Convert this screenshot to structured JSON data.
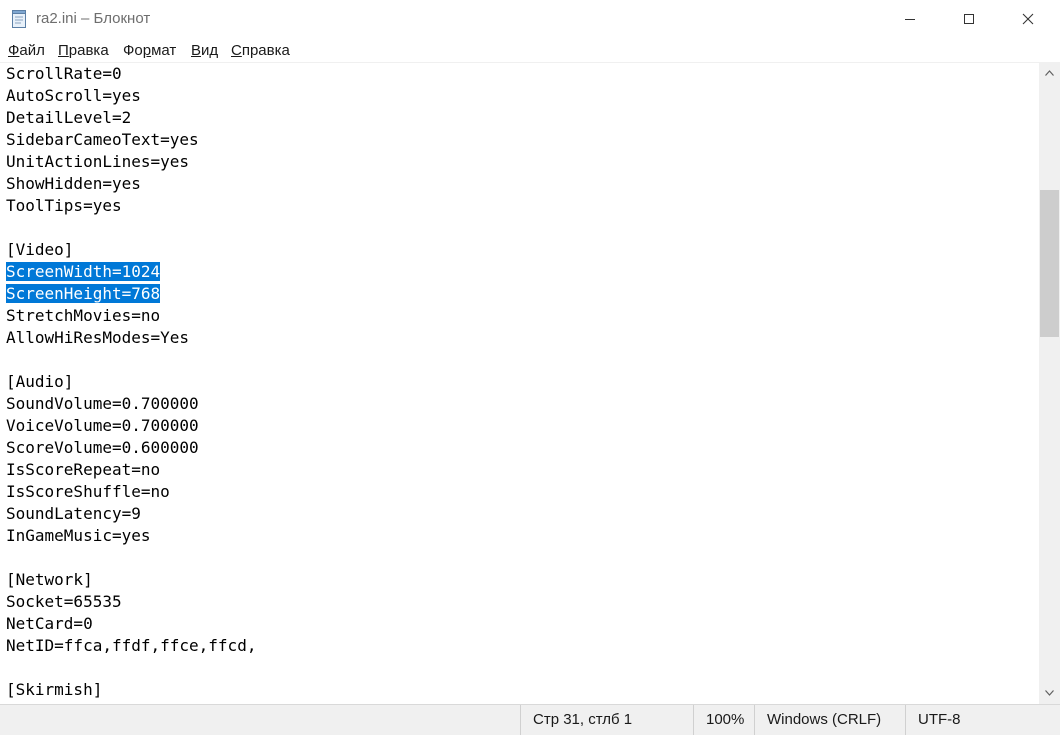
{
  "window": {
    "title": "ra2.ini – Блокнот",
    "icon": "notepad-icon",
    "controls": [
      "minimize-icon",
      "maximize-icon",
      "close-icon"
    ]
  },
  "menu": [
    {
      "accel": "Ф",
      "rest": "айл"
    },
    {
      "accel": "П",
      "rest": "равка"
    },
    {
      "accel": "",
      "pre": "Фо",
      "accel2": "р",
      "rest": "мат"
    },
    {
      "accel": "В",
      "rest": "ид"
    },
    {
      "accel": "С",
      "rest": "правка"
    }
  ],
  "editor": {
    "lines": [
      "ScrollRate=0",
      "AutoScroll=yes",
      "DetailLevel=2",
      "SidebarCameoText=yes",
      "UnitActionLines=yes",
      "ShowHidden=yes",
      "ToolTips=yes",
      "",
      "[Video]",
      "ScreenWidth=1024",
      "ScreenHeight=768",
      "StretchMovies=no",
      "AllowHiResModes=Yes",
      "",
      "[Audio]",
      "SoundVolume=0.700000",
      "VoiceVolume=0.700000",
      "ScoreVolume=0.600000",
      "IsScoreRepeat=no",
      "IsScoreShuffle=no",
      "SoundLatency=9",
      "InGameMusic=yes",
      "",
      "[Network]",
      "Socket=65535",
      "NetCard=0",
      "NetID=ffca,ffdf,ffce,ffcd,",
      "",
      "[Skirmish]"
    ],
    "selected_lines": [
      9,
      10
    ],
    "selection_color": "#0078d7"
  },
  "status": {
    "position": "Стр 31, стлб 1",
    "zoom": "100%",
    "line_ending": "Windows (CRLF)",
    "encoding": "UTF-8"
  }
}
